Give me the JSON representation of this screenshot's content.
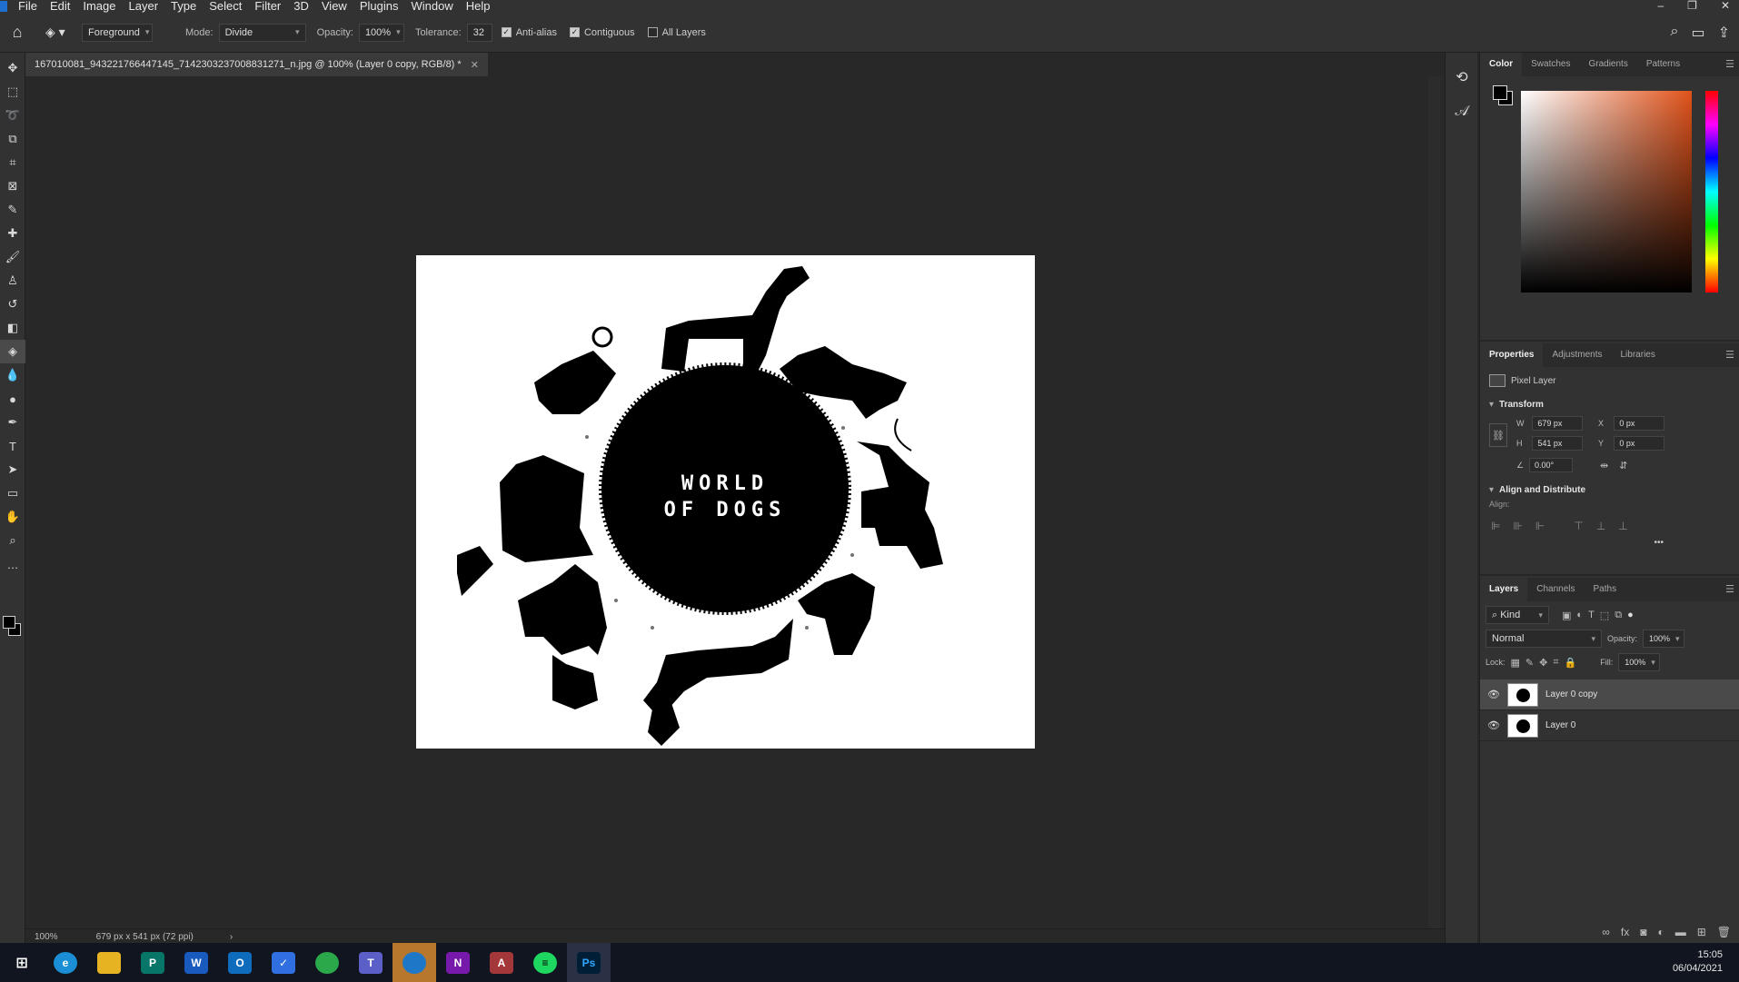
{
  "menubar": {
    "items": [
      "File",
      "Edit",
      "Image",
      "Layer",
      "Type",
      "Select",
      "Filter",
      "3D",
      "View",
      "Plugins",
      "Window",
      "Help"
    ],
    "win_minimize": "–",
    "win_restore": "❐",
    "win_close": "✕"
  },
  "options": {
    "fill_source": "Foreground",
    "mode_label": "Mode:",
    "mode_value": "Divide",
    "opacity_label": "Opacity:",
    "opacity_value": "100%",
    "tolerance_label": "Tolerance:",
    "tolerance_value": "32",
    "anti_alias": "Anti-alias",
    "contiguous": "Contiguous",
    "all_layers": "All Layers"
  },
  "document": {
    "tab_title": "167010081_943221766447145_7142303237008831271_n.jpg @ 100% (Layer 0 copy, RGB/8) *",
    "artwork_text_line1": "WORLD",
    "artwork_text_line2": "OF DOGS"
  },
  "status": {
    "zoom": "100%",
    "doc_info": "679 px x 541 px (72 ppi)",
    "arrow": "›"
  },
  "color_panel": {
    "tabs": [
      "Color",
      "Swatches",
      "Gradients",
      "Patterns"
    ],
    "foreground": "#000000",
    "background": "#000000",
    "hue_accent": "#e0521a"
  },
  "properties_panel": {
    "tabs": [
      "Properties",
      "Adjustments",
      "Libraries"
    ],
    "kind": "Pixel Layer",
    "transform_title": "Transform",
    "w_label": "W",
    "w_value": "679 px",
    "h_label": "H",
    "h_value": "541 px",
    "x_label": "X",
    "x_value": "0 px",
    "y_label": "Y",
    "y_value": "0 px",
    "angle_value": "0.00°",
    "align_title": "Align and Distribute",
    "align_label": "Align:",
    "more": "•••"
  },
  "layers_panel": {
    "tabs": [
      "Layers",
      "Channels",
      "Paths"
    ],
    "filter_kind": "Kind",
    "blend_mode": "Normal",
    "opacity_label": "Opacity:",
    "opacity_value": "100%",
    "lock_label": "Lock:",
    "fill_label": "Fill:",
    "fill_value": "100%",
    "layers": [
      {
        "name": "Layer 0 copy",
        "selected": true
      },
      {
        "name": "Layer 0",
        "selected": false
      }
    ]
  },
  "taskbar": {
    "apps": [
      {
        "icon": "windows-start-icon",
        "color": "#10151f"
      },
      {
        "icon": "edge-icon",
        "color": "#1b8fd6"
      },
      {
        "icon": "file-explorer-icon",
        "color": "#e6b422"
      },
      {
        "icon": "publisher-icon",
        "color": "#077568"
      },
      {
        "icon": "word-icon",
        "color": "#185abd"
      },
      {
        "icon": "outlook-icon",
        "color": "#0f6cbd"
      },
      {
        "icon": "todo-icon",
        "color": "#2f6fe0"
      },
      {
        "icon": "greenshot-icon",
        "color": "#2aa84a"
      },
      {
        "icon": "teams-icon",
        "color": "#5b5fc7"
      },
      {
        "icon": "blue-app-icon",
        "color": "#1f77c8"
      },
      {
        "icon": "onenote-icon",
        "color": "#7719aa"
      },
      {
        "icon": "access-icon",
        "color": "#a4373a"
      },
      {
        "icon": "spotify-icon",
        "color": "#1ed760"
      },
      {
        "icon": "photoshop-icon",
        "color": "#001e36"
      }
    ],
    "time": "15:05",
    "date": "06/04/2021"
  }
}
